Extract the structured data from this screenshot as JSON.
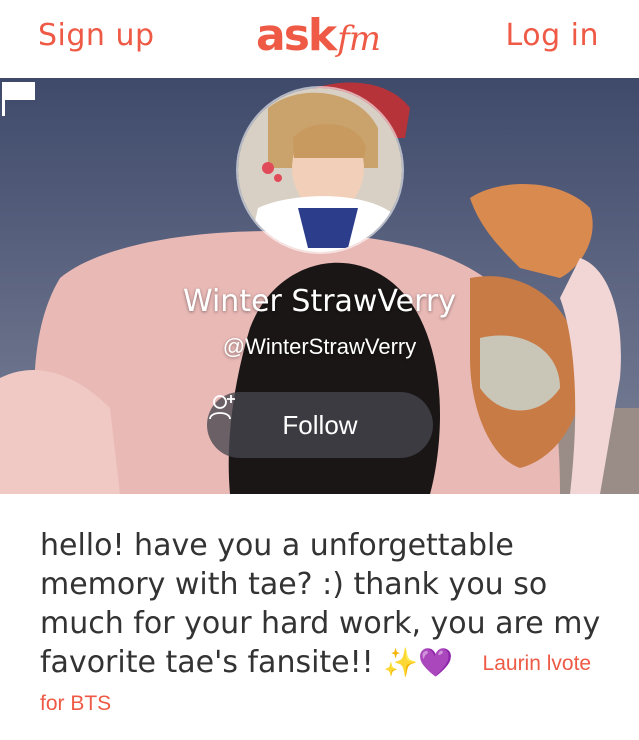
{
  "header": {
    "signup_label": "Sign up",
    "logo_ask": "ask",
    "logo_fm": "fm",
    "login_label": "Log in"
  },
  "profile": {
    "display_name": "Winter StrawVerry",
    "username": "@WinterStrawVerry",
    "follow_label": "Follow"
  },
  "question": {
    "text": "hello! have you a unforgettable memory with tae? :) thank you so much for your hard work, you are my favorite tae's fansite!!",
    "emojis": "✨💜",
    "asker": "Laurin lvote for BTS"
  },
  "colors": {
    "brand": "#ee5a45",
    "text": "#333333"
  }
}
